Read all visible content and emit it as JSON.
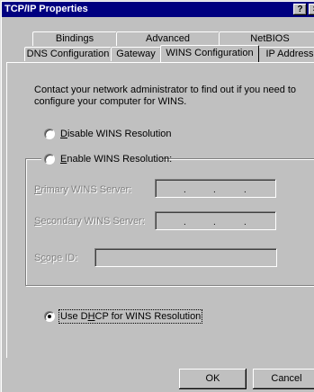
{
  "window": {
    "title": "TCP/IP Properties",
    "help_glyph": "?",
    "close_glyph": "×"
  },
  "tabs_back": [
    {
      "label": "Bindings"
    },
    {
      "label": "Advanced"
    },
    {
      "label": "NetBIOS"
    }
  ],
  "tabs_front": [
    {
      "label": "DNS Configuration"
    },
    {
      "label": "Gateway"
    },
    {
      "label": "WINS Configuration",
      "active": true
    },
    {
      "label": "IP Address"
    }
  ],
  "wins": {
    "description": "Contact your network administrator to find out if you need to configure your computer for WINS.",
    "disable": {
      "prefix": "",
      "accel": "D",
      "rest": "isable WINS Resolution",
      "selected": false
    },
    "enable": {
      "prefix": "",
      "accel": "E",
      "rest": "nable WINS Resolution:",
      "selected": false
    },
    "primary": {
      "prefix": "",
      "accel": "P",
      "rest": "rimary WINS Server:"
    },
    "secondary": {
      "prefix": "",
      "accel": "S",
      "rest": "econdary WINS Server:"
    },
    "scope": {
      "prefix": "S",
      "accel": "c",
      "rest": "ope ID:"
    },
    "dhcp": {
      "prefix": "Use D",
      "accel": "H",
      "rest": "CP for WINS Resolution",
      "selected": true
    }
  },
  "ip_separator": ".",
  "buttons": {
    "ok": "OK",
    "cancel": "Cancel"
  }
}
